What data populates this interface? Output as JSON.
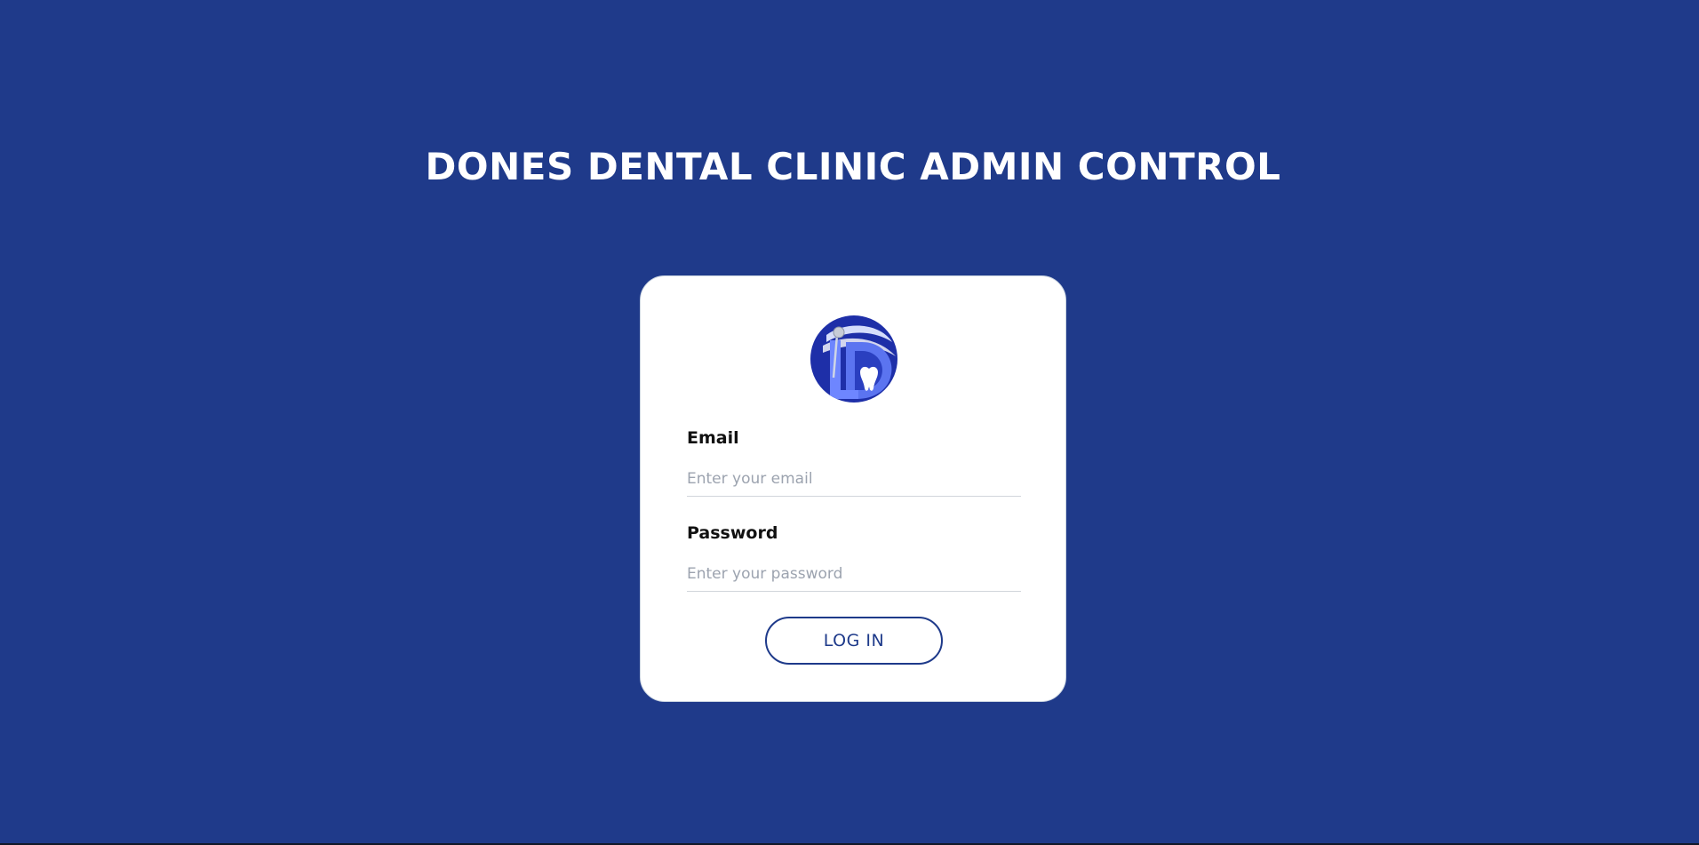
{
  "header": {
    "title": "DONES DENTAL CLINIC ADMIN CONTROL"
  },
  "login_form": {
    "logo_icon": "dental-clinic-logo-icon",
    "email": {
      "label": "Email",
      "placeholder": "Enter your email",
      "value": ""
    },
    "password": {
      "label": "Password",
      "placeholder": "Enter your password",
      "value": ""
    },
    "submit_label": "LOG IN"
  },
  "colors": {
    "background": "#1f3a8a",
    "card": "#ffffff",
    "accent": "#1e3a8a",
    "logo_circle": "#1e2fa8"
  }
}
